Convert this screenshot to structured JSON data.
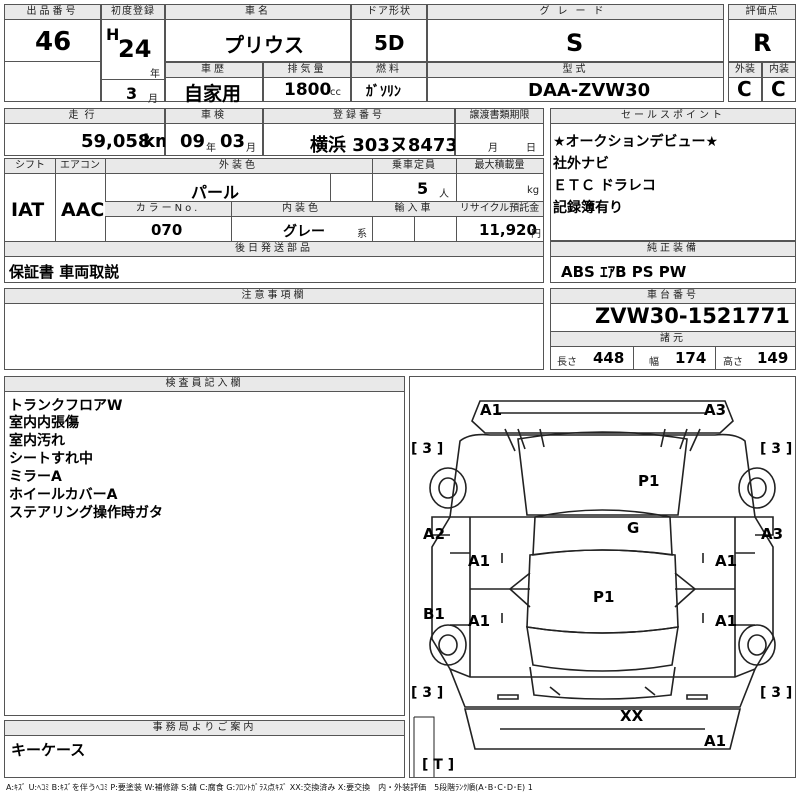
{
  "header": {
    "lot_label": "出品番号",
    "lot": "46",
    "first_reg_label": "初度登録",
    "era": "H",
    "year": "24",
    "year_unit": "年",
    "month": "3",
    "month_unit": "月",
    "name_label": "車名",
    "name": "プリウス",
    "door_label": "ドア形状",
    "door": "5D",
    "grade_label": "グレード",
    "grade": "S",
    "score_label": "評価点",
    "score": "R",
    "history_label": "車歴",
    "history": "自家用",
    "disp_label": "排気量",
    "disp": "1800",
    "disp_unit": "cc",
    "fuel_label": "燃料",
    "fuel": "ｶﾞｿﾘﾝ",
    "model_label": "型式",
    "model": "DAA-ZVW30",
    "ext_label": "外装",
    "ext": "C",
    "int_label": "内装",
    "int": "C"
  },
  "row2": {
    "mileage_label": "走行",
    "mileage": "59,058",
    "mileage_unit": "km",
    "inspection_label": "車検",
    "insp_year": "09",
    "insp_year_unit": "年",
    "insp_month": "03",
    "insp_month_unit": "月",
    "reg_label": "登録番号",
    "reg": "横浜 303ヌ8473",
    "transfer_label": "譲渡書類期限",
    "transfer_month": "月",
    "transfer_day": "日"
  },
  "row3": {
    "shift_label": "シフト",
    "shift": "IAT",
    "ac_label": "エアコン",
    "ac": "AAC",
    "exterior_color_label": "外装色",
    "exterior_color": "パール",
    "capacity_label": "乗車定員",
    "capacity": "5",
    "capacity_unit": "人",
    "load_label": "最大積載量",
    "load_unit": "kg",
    "color_no_label": "カラーNo.",
    "color_no": "070",
    "interior_color_label": "内装色",
    "interior_color": "グレー",
    "interior_unit": "系",
    "import_label": "輸入車",
    "recycle_label": "リサイクル預託金",
    "recycle": "11,920",
    "recycle_unit": "円"
  },
  "sales_point": {
    "label": "セールスポイント",
    "lines": [
      "★オークションデビュー★",
      "社外ナビ",
      "ＥＴＣ ドラレコ",
      "記録簿有り"
    ]
  },
  "later_parts": {
    "label": "後日発送部品",
    "value": "保証書 車両取説"
  },
  "equipment": {
    "label": "純正装備",
    "value": "ABS ｴｱB PS PW"
  },
  "caution": {
    "label": "注意事項欄"
  },
  "chassis": {
    "label": "車台番号",
    "value": "ZVW30-1521771"
  },
  "specs": {
    "label": "諸元",
    "length_label": "長さ",
    "length": "448",
    "width_label": "幅",
    "width": "174",
    "height_label": "高さ",
    "height": "149"
  },
  "inspector": {
    "label": "検査員記入欄",
    "lines": [
      "トランクフロアW",
      "室内内張傷",
      "室内汚れ",
      "シートすれ中",
      "ミラーA",
      "ホイールカバーA",
      "ステアリング操作時ガタ"
    ]
  },
  "office": {
    "label": "事務局よりご案内",
    "value": "キーケース"
  },
  "diagram": {
    "marks": {
      "a1_top": "A1",
      "a3_top": "A3",
      "p1_hood": "P1",
      "g": "G",
      "a2": "A2",
      "a3_right": "A3",
      "a1_left_front": "A1",
      "a1_right_front": "A1",
      "p1_roof": "P1",
      "b1": "B1",
      "a1_left_rear": "A1",
      "a1_right_rear": "A1",
      "xx": "XX",
      "a1_bottom": "A1"
    },
    "tire_tl": "[ 3 ]",
    "tire_tr": "[ 3 ]",
    "tire_bl": "[ 3 ]",
    "tire_br": "[ 3 ]",
    "spare": "[ T ]"
  },
  "legend": "A:ｷｽﾞ U:ﾍｺﾐ B:ｷｽﾞを伴うﾍｺﾐ P:要塗装 W:補修跡 S:錆 C:腐食 G:ﾌﾛﾝﾄｶﾞﾗｽ点ｷｽﾞ XX:交換済み X:要交換　内・外装評価　5段階ﾗﾝｸ順(A･B･C･D･E) 1"
}
